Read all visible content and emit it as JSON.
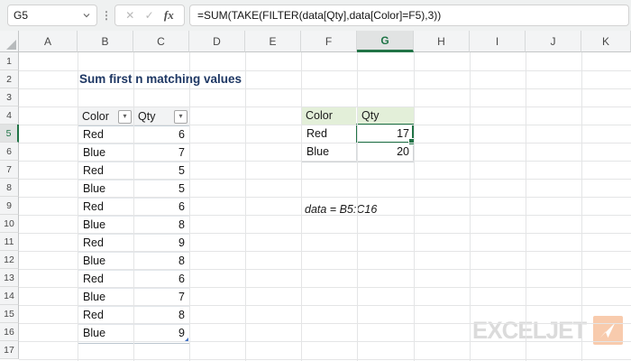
{
  "formula_bar": {
    "name_box_value": "G5",
    "cancel_icon": "✕",
    "enter_icon": "✓",
    "fx_icon": "fx",
    "separator": "⋮",
    "formula": "=SUM(TAKE(FILTER(data[Qty],data[Color]=F5),3))"
  },
  "sheet": {
    "column_letters": [
      "A",
      "B",
      "C",
      "D",
      "E",
      "F",
      "G",
      "H",
      "I",
      "J",
      "K"
    ],
    "selected_column": "G",
    "row_numbers": [
      "1",
      "2",
      "3",
      "4",
      "5",
      "6",
      "7",
      "8",
      "9",
      "10",
      "11",
      "12",
      "13",
      "14",
      "15",
      "16",
      "17"
    ],
    "selected_row": "5",
    "title": "Sum first n matching values",
    "note": "data = B5:C16"
  },
  "source_table": {
    "range": "B4:C16",
    "headers": [
      "Color",
      "Qty"
    ],
    "filter_icon": "▾",
    "rows": [
      [
        "Red",
        "6"
      ],
      [
        "Blue",
        "7"
      ],
      [
        "Red",
        "5"
      ],
      [
        "Blue",
        "5"
      ],
      [
        "Red",
        "6"
      ],
      [
        "Blue",
        "8"
      ],
      [
        "Red",
        "9"
      ],
      [
        "Blue",
        "8"
      ],
      [
        "Red",
        "6"
      ],
      [
        "Blue",
        "7"
      ],
      [
        "Red",
        "8"
      ],
      [
        "Blue",
        "9"
      ]
    ]
  },
  "result_table": {
    "range": "F4:G6",
    "headers": [
      "Color",
      "Qty"
    ],
    "rows": [
      [
        "Red",
        "17"
      ],
      [
        "Blue",
        "20"
      ]
    ],
    "selected_cell": "G5",
    "selected_value": "17"
  },
  "logo": {
    "text": "EXCELJET"
  },
  "colors": {
    "selection_green": "#217346",
    "title_blue": "#1f3864",
    "result_header_bg": "#e3efd9",
    "table_handle_blue": "#4472c4",
    "logo_gray": "#dbdbdb",
    "logo_orange": "#f8cbad"
  }
}
